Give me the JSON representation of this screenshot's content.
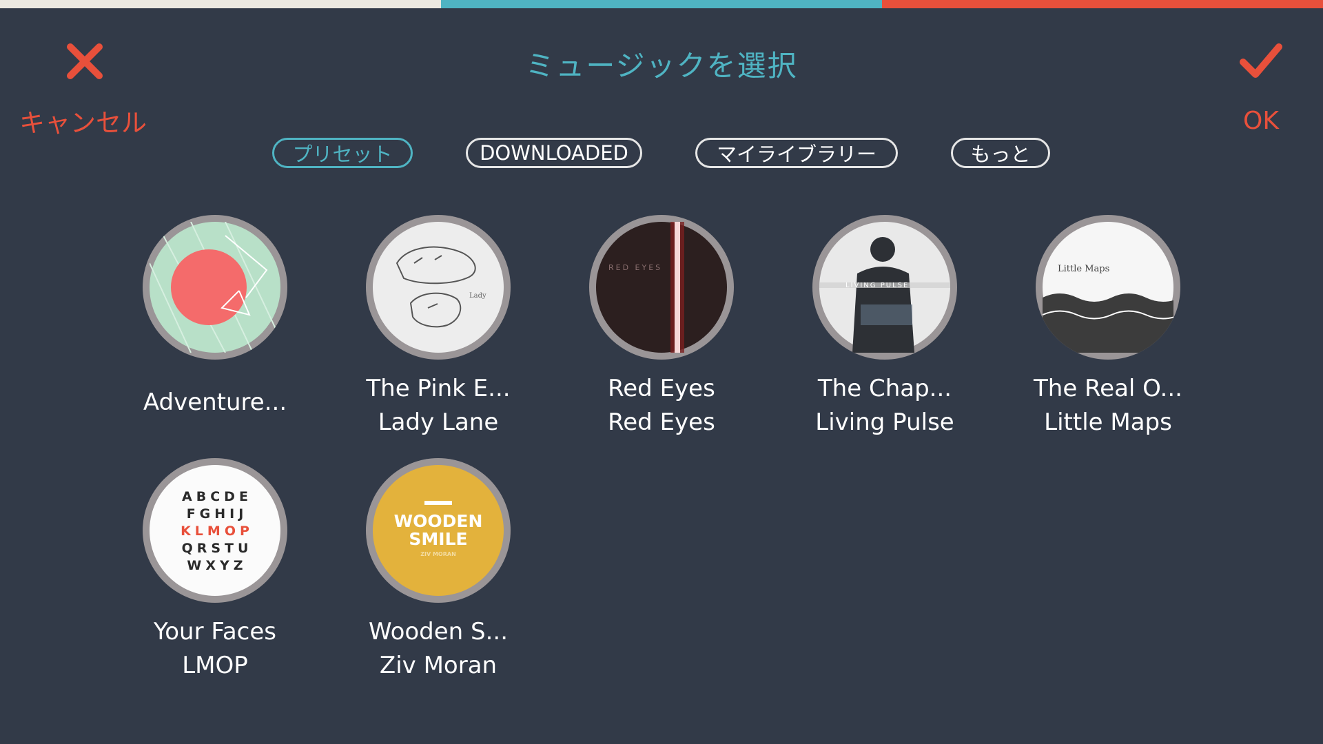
{
  "colors": {
    "accent": "#4fb4c3",
    "cancel": "#e8503b",
    "background": "#323a48",
    "tab_border": "#e6e6e6"
  },
  "topbar_colors": [
    "#ece9e1",
    "#4fb4c3",
    "#e8503b"
  ],
  "header": {
    "title": "ミュージックを選択",
    "cancel_icon": "close-icon",
    "cancel_label": "キャンセル",
    "ok_icon": "checkmark-icon",
    "ok_label": "OK"
  },
  "tabs": [
    {
      "label": "プリセット",
      "active": true
    },
    {
      "label": "DOWNLOADED",
      "active": false
    },
    {
      "label": "マイライブラリー",
      "active": false
    },
    {
      "label": "もっと",
      "active": false
    }
  ],
  "albums": [
    {
      "title": "Adventure...",
      "artist": ""
    },
    {
      "title": "The Pink E...",
      "artist": "Lady Lane"
    },
    {
      "title": "Red Eyes",
      "artist": "Red Eyes",
      "cover_text": "RED EYES"
    },
    {
      "title": "The Chap...",
      "artist": "Living Pulse",
      "cover_text": "LIVING PULSE"
    },
    {
      "title": "The Real O...",
      "artist": "Little Maps",
      "cover_text": "Little Maps"
    },
    {
      "title": "Your Faces",
      "artist": "LMOP",
      "cover_rows": [
        "ABCDE",
        "FGHIJ",
        "KLMOP",
        "QRSTU",
        "WXYZ"
      ]
    },
    {
      "title": "Wooden S...",
      "artist": "Ziv Moran",
      "cover_text": [
        "WOODEN",
        "SMILE",
        "ZIV MORAN"
      ]
    }
  ]
}
